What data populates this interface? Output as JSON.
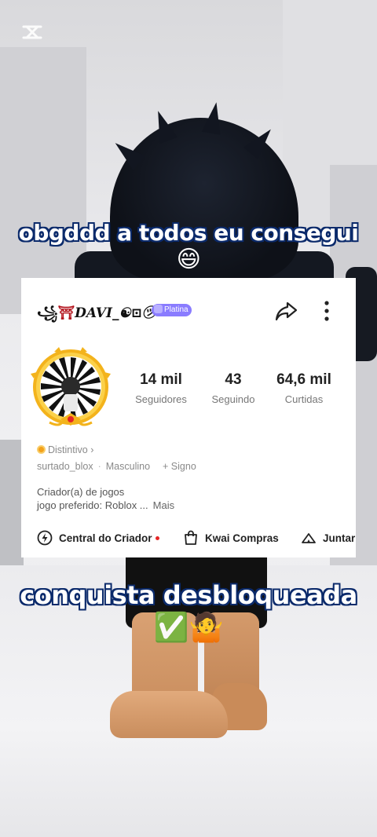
{
  "overlay": {
    "top_caption": "obgddd a todos eu consegui",
    "top_emoji": "😄",
    "bottom_caption": "conquista desbloqueada",
    "bottom_emojis": "✅🤷"
  },
  "profile": {
    "username_prefix": "꧁",
    "username_deco": "⛩",
    "username": "DAVI_☯︎⊡㋡",
    "badge": "Platina",
    "stats": [
      {
        "value": "14 mil",
        "label": "Seguidores"
      },
      {
        "value": "43",
        "label": "Seguindo"
      },
      {
        "value": "64,6 mil",
        "label": "Curtidas"
      }
    ],
    "distintivo": "Distintivo",
    "distintivo_chevron": "›",
    "handle": "surtado_blox",
    "separator": "·",
    "gender": "Masculino",
    "sign": "+ Signo",
    "bio_line1": "Criador(a) de jogos",
    "bio_line2": "jogo preferido: Roblox ...",
    "bio_more": "Mais"
  },
  "actions": [
    {
      "label": "Central do Criador",
      "icon": "lightning-icon"
    },
    {
      "label": "Kwai Compras",
      "icon": "shopping-bag-icon"
    },
    {
      "label": "Juntar",
      "icon": "tent-icon"
    }
  ],
  "colors": {
    "caption_outline": "#0b2a6b",
    "badge_bg": "#8a7cff",
    "coin": "#f3a11a",
    "notification_dot": "#e52525"
  }
}
